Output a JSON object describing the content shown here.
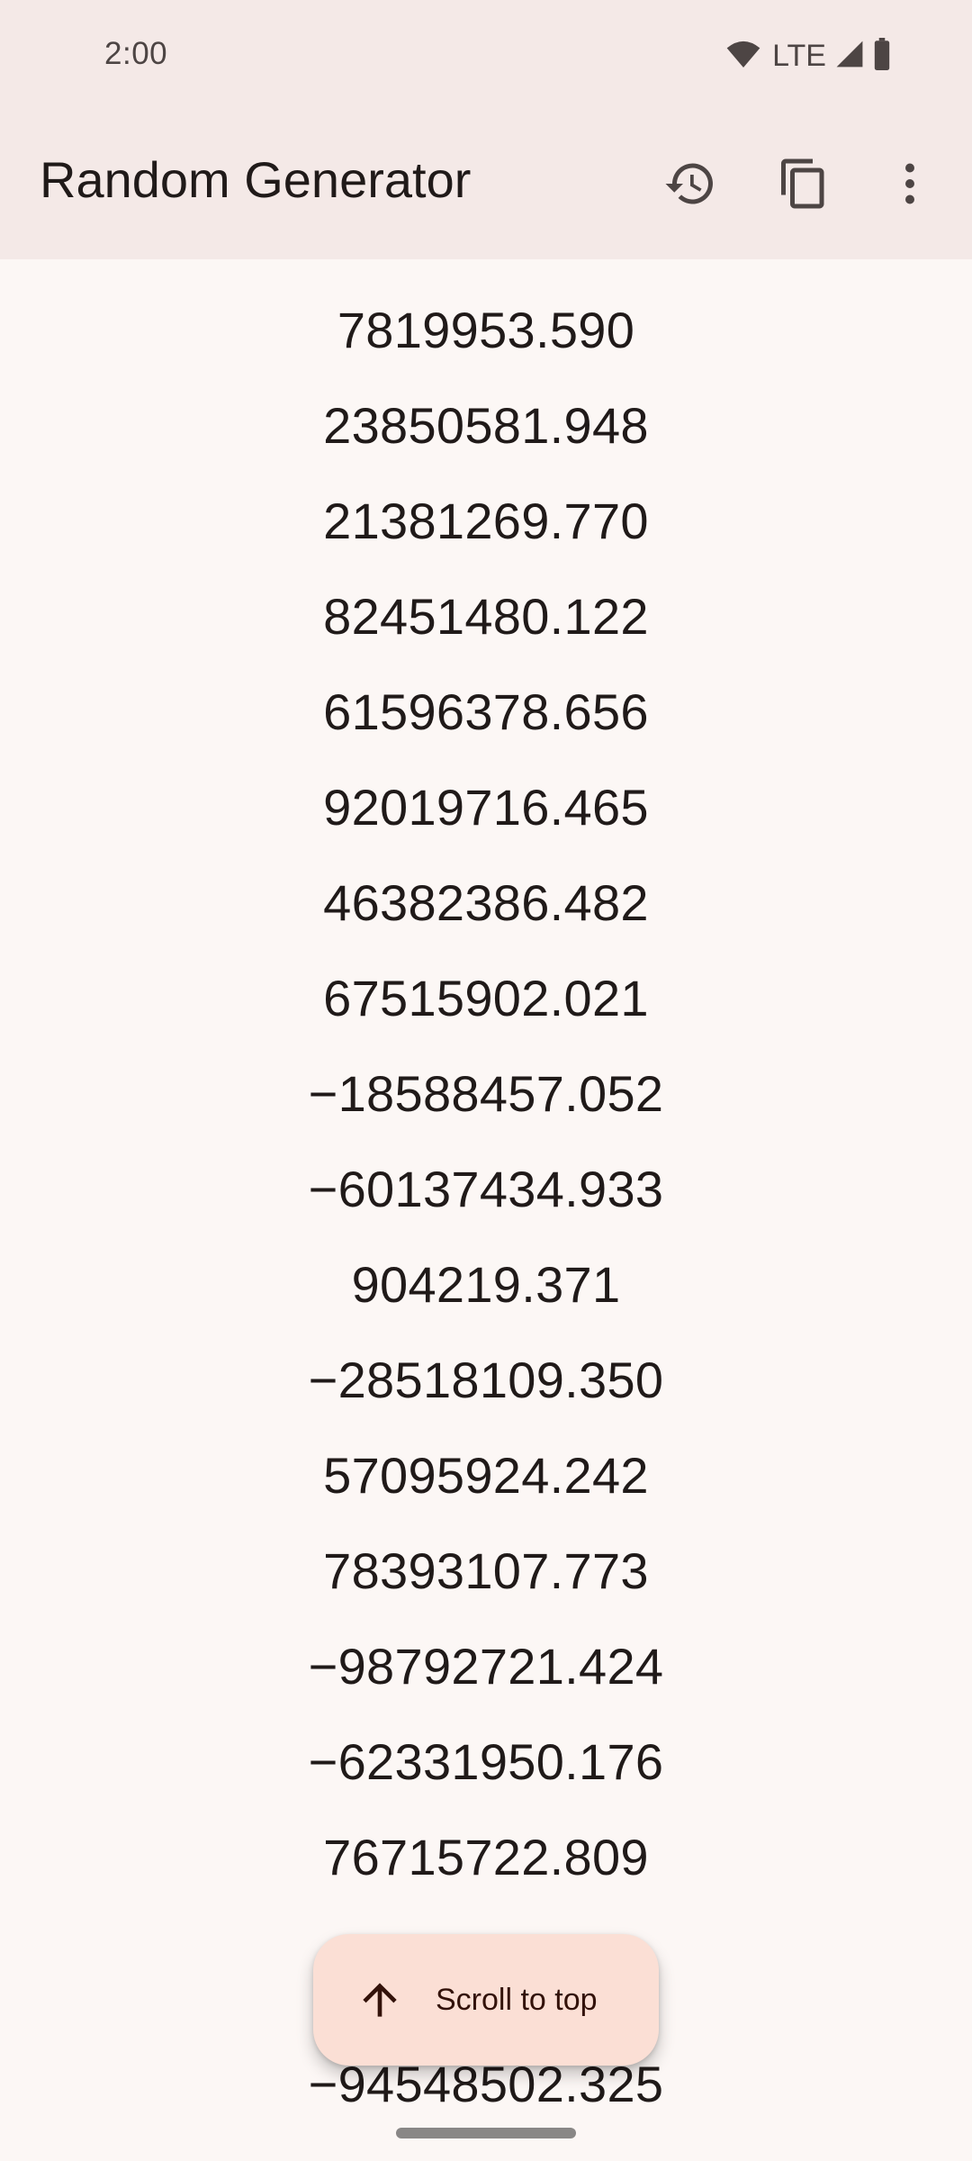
{
  "status_bar": {
    "time": "2:00",
    "network": "LTE",
    "icons": [
      "wifi-icon",
      "lte-label",
      "cell-signal-icon",
      "battery-icon"
    ]
  },
  "app_bar": {
    "title": "Random Generator",
    "actions": [
      {
        "name": "history",
        "icon": "history-icon"
      },
      {
        "name": "copy",
        "icon": "copy-icon"
      },
      {
        "name": "more-options",
        "icon": "more-vert-icon"
      }
    ]
  },
  "results": [
    "7819953.590",
    "23850581.948",
    "21381269.770",
    "82451480.122",
    "61596378.656",
    "92019716.465",
    "46382386.482",
    "67515902.021",
    "−18588457.052",
    "−60137434.933",
    "904219.371",
    "−28518109.350",
    "57095924.242",
    "78393107.773",
    "−98792721.424",
    "−62331950.176",
    "76715722.809",
    "",
    "",
    "−94548502.325"
  ],
  "fab": {
    "label": "Scroll to top",
    "icon": "arrow-up-icon"
  },
  "colors": {
    "app_bar_bg": "#f4e9e7",
    "surface_bg": "#fcf7f5",
    "fab_bg": "#fbdfd5",
    "fab_fg": "#33120a",
    "icon_color": "#4d4544"
  }
}
